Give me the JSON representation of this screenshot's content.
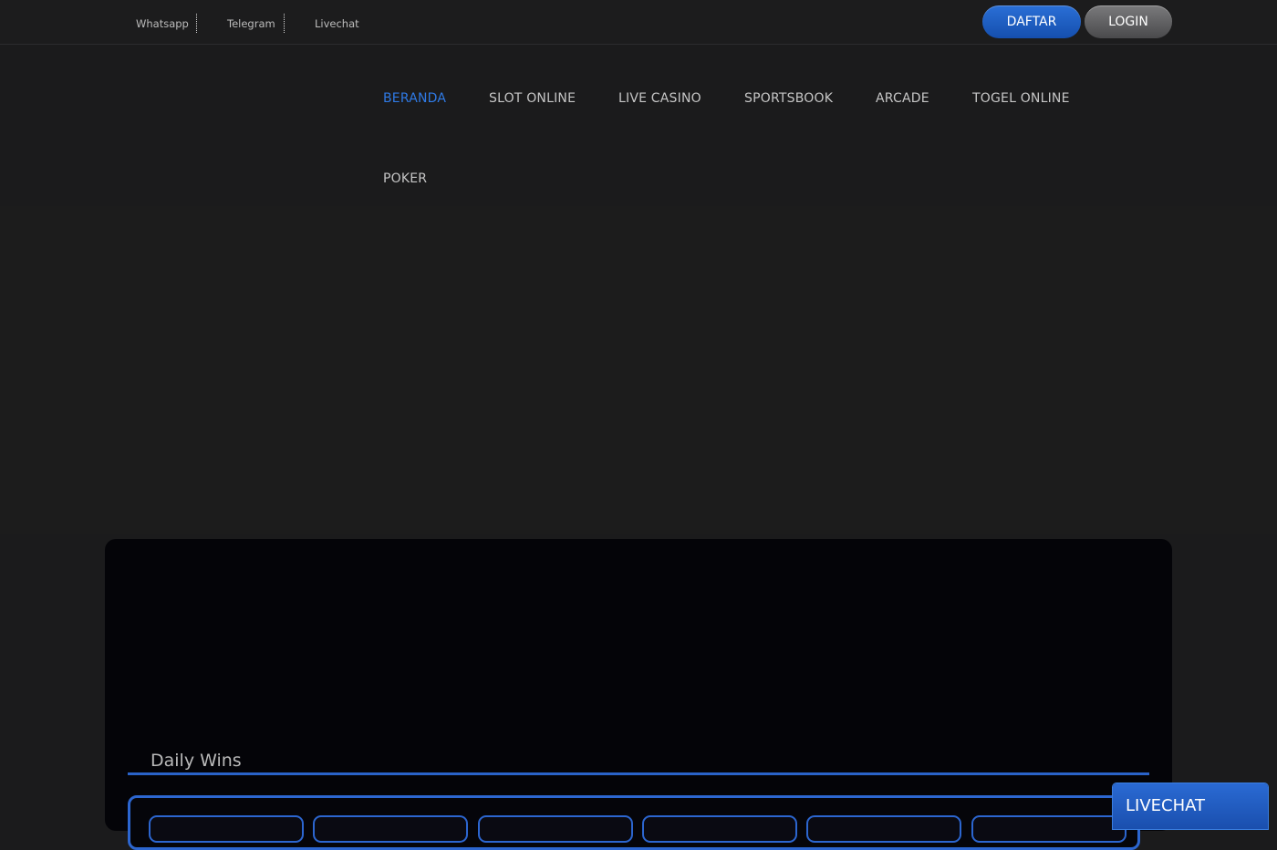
{
  "topbar": {
    "contacts": [
      "Whatsapp",
      "Telegram",
      "Livechat"
    ],
    "register_label": "DAFTAR",
    "login_label": "LOGIN"
  },
  "nav": {
    "items": [
      {
        "label": "BERANDA",
        "active": true
      },
      {
        "label": "SLOT ONLINE",
        "active": false
      },
      {
        "label": "LIVE CASINO",
        "active": false
      },
      {
        "label": "SPORTSBOOK",
        "active": false
      },
      {
        "label": "ARCADE",
        "active": false
      },
      {
        "label": "TOGEL ONLINE",
        "active": false
      },
      {
        "label": "POKER",
        "active": false
      }
    ]
  },
  "daily_wins": {
    "title": "Daily Wins"
  },
  "livechat_widget": {
    "label": "LIVECHAT"
  },
  "colors": {
    "accent": "#2f7ae5",
    "background": "#1b1b1c",
    "panel": "#040408"
  }
}
